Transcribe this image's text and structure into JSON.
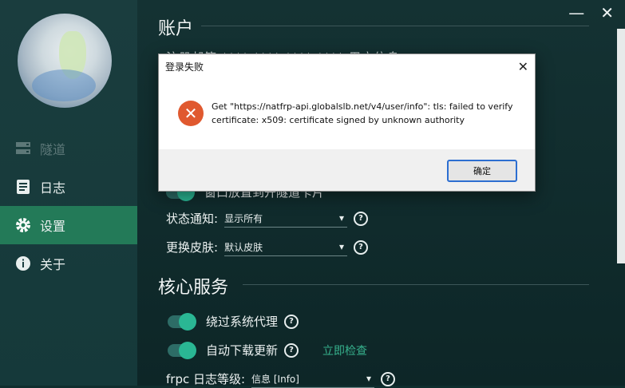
{
  "window": {
    "minimize_glyph": "—",
    "close_glyph": "✕"
  },
  "sidebar": {
    "items": [
      {
        "label": "隧道",
        "icon": "server-icon",
        "disabled": true
      },
      {
        "label": "日志",
        "icon": "log-icon"
      },
      {
        "label": "设置",
        "icon": "gear-icon",
        "active": true
      },
      {
        "label": "关于",
        "icon": "info-icon"
      }
    ]
  },
  "settings": {
    "account_title": "账户",
    "account_line": "注册邮箱 **** ****  ****  ****    用户信息",
    "behind_toggle_label": "窗口放置到开隧道卡片",
    "status_notify": {
      "label": "状态通知:",
      "value": "显示所有"
    },
    "skin": {
      "label": "更换皮肤:",
      "value": "默认皮肤"
    },
    "core_title": "核心服务",
    "bypass_proxy": {
      "label": "绕过系统代理"
    },
    "auto_update": {
      "label": "自动下载更新",
      "link": "立即检查"
    },
    "log_level": {
      "label": "frpc 日志等级:",
      "value": "信息 [Info]"
    }
  },
  "dialog": {
    "title": "登录失败",
    "message": "Get \"https://natfrp-api.globalslb.net/v4/user/info\": tls: failed to verify certificate: x509: certificate signed by unknown authority",
    "ok_label": "确定",
    "close_glyph": "✕",
    "error_glyph": "✕"
  },
  "colors": {
    "accent": "#237a58",
    "toggle_knob": "#2ab794",
    "link": "#37b28d",
    "error": "#e0592f"
  }
}
